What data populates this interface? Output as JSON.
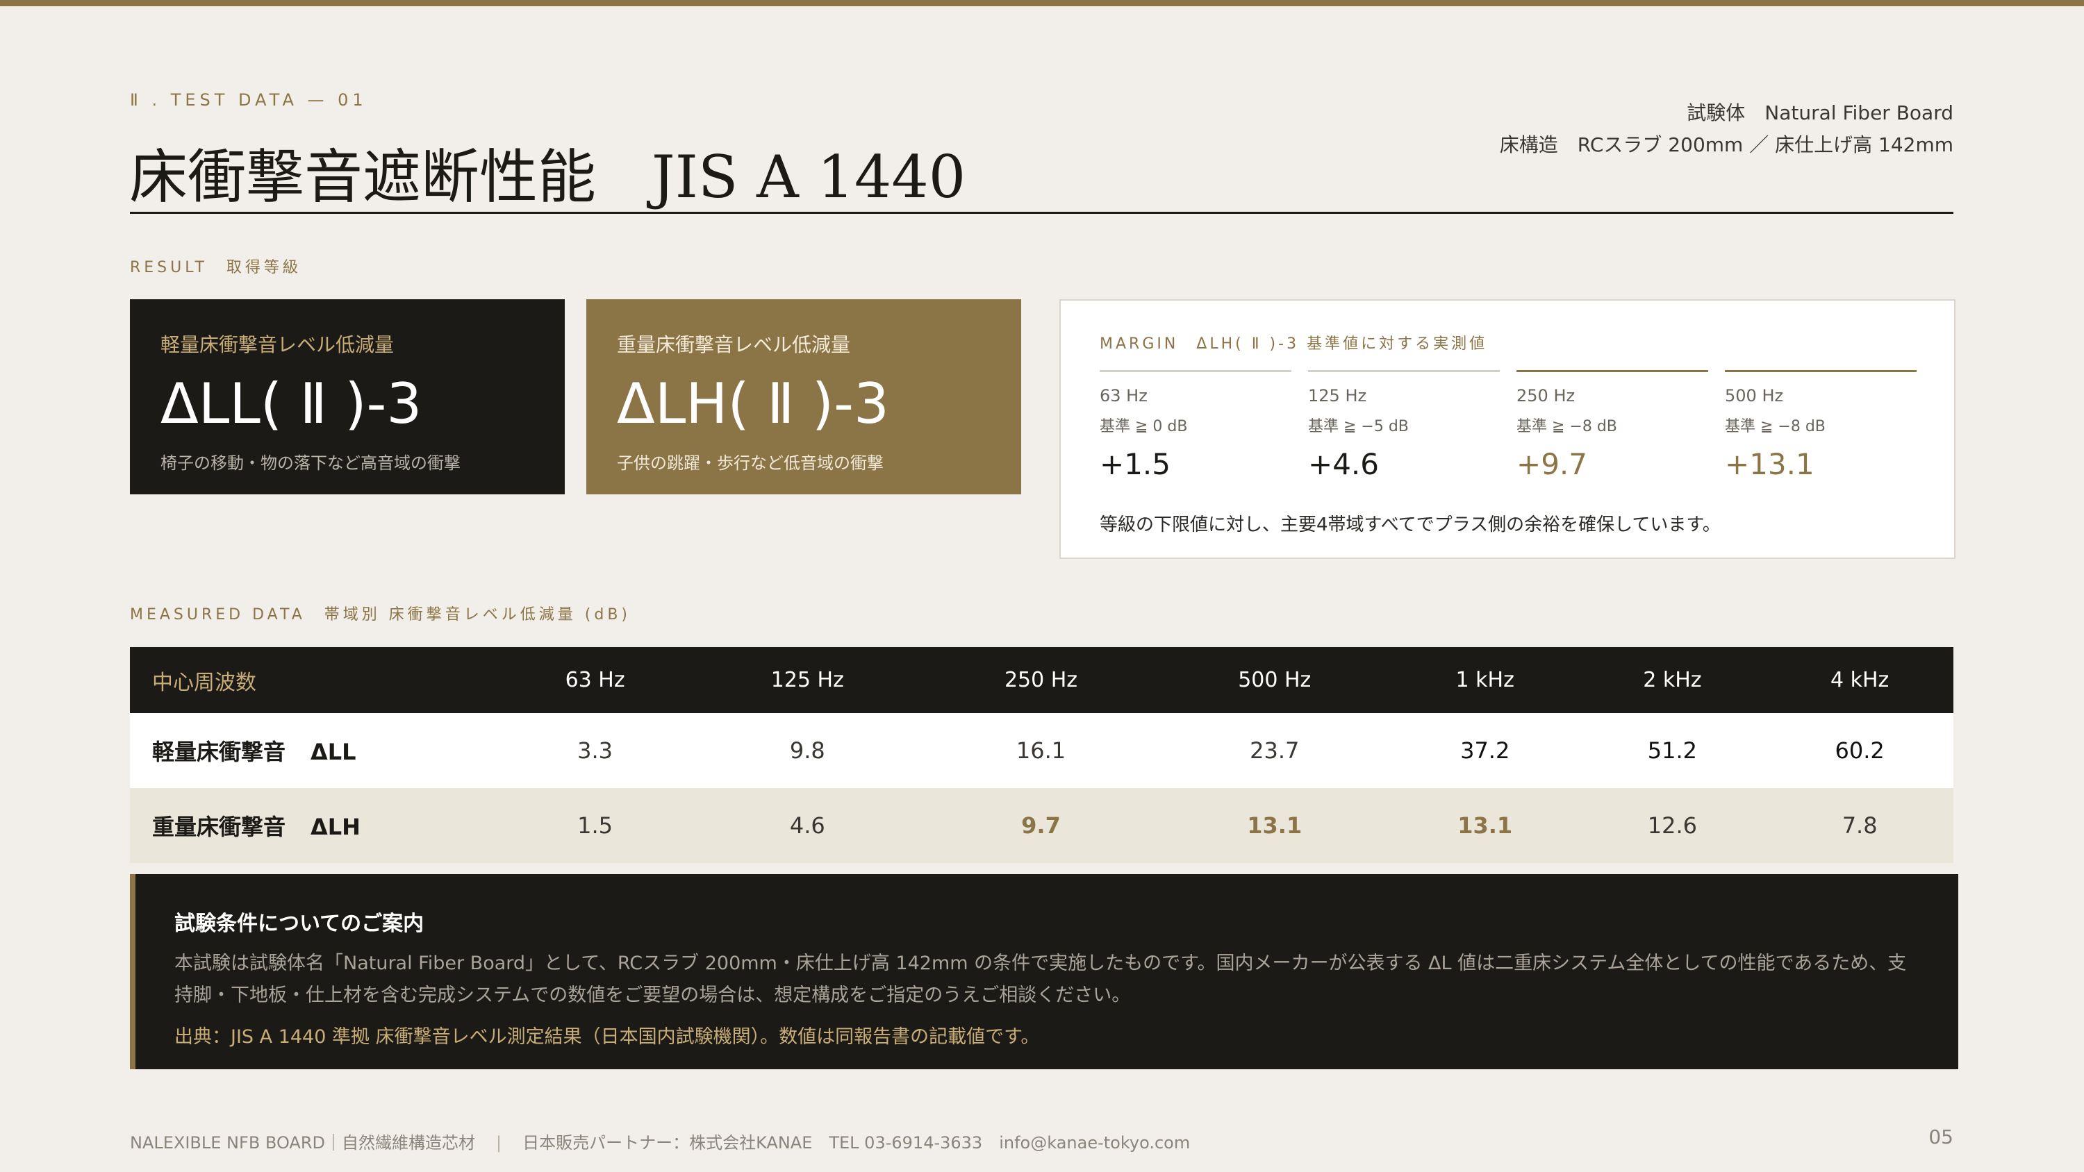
{
  "header": {
    "eyebrow": "Ⅱ . TEST DATA — 01",
    "title_ja": "床衝撃音遮断性能",
    "title_std": "JIS A 1440",
    "meta": [
      {
        "key": "試験体",
        "value": "Natural Fiber Board"
      },
      {
        "key": "床構造",
        "value": "RCスラブ 200mm ／ 床仕上げ高 142mm"
      }
    ]
  },
  "result": {
    "label": "RESULT　取得等級",
    "cards": [
      {
        "caption": "軽量床衝撃音レベル低減量",
        "grade": "ΔLL( Ⅱ )-3",
        "desc": "椅子の移動・物の落下など高音域の衝撃"
      },
      {
        "caption": "重量床衝撃音レベル低減量",
        "grade": "ΔLH( Ⅱ )-3",
        "desc": "子供の跳躍・歩行など低音域の衝撃"
      }
    ]
  },
  "margin": {
    "title": "MARGIN　ΔLH( Ⅱ )-3 基準値に対する実測値",
    "cols": [
      {
        "hz": "63 Hz",
        "std": "基準 ≧ 0 dB",
        "val": "+1.5"
      },
      {
        "hz": "125 Hz",
        "std": "基準 ≧ −5 dB",
        "val": "+4.6"
      },
      {
        "hz": "250 Hz",
        "std": "基準 ≧ −8 dB",
        "val": "+9.7"
      },
      {
        "hz": "500 Hz",
        "std": "基準 ≧ −8 dB",
        "val": "+13.1"
      }
    ],
    "note": "等級の下限値に対し、主要4帯域すべてでプラス側の余裕を確保しています。"
  },
  "measured": {
    "label": "MEASURED DATA　帯域別 床衝撃音レベル低減量 (dB)",
    "header": [
      "中心周波数",
      "63 Hz",
      "125 Hz",
      "250 Hz",
      "500 Hz",
      "1 kHz",
      "2 kHz",
      "4 kHz"
    ],
    "rows": [
      {
        "name": "軽量床衝撃音",
        "sym": "ΔLL",
        "values": [
          "3.3",
          "9.8",
          "16.1",
          "23.7",
          "37.2",
          "51.2",
          "60.2"
        ]
      },
      {
        "name": "重量床衝撃音",
        "sym": "ΔLH",
        "values": [
          "1.5",
          "4.6",
          "9.7",
          "13.1",
          "13.1",
          "12.6",
          "7.8"
        ]
      }
    ]
  },
  "info": {
    "title": "試験条件についてのご案内",
    "body": "本試験は試験体名「Natural Fiber Board」として、RCスラブ 200mm・床仕上げ高 142mm の条件で実施したものです。国内メーカーが公表する ΔL 値は二重床システム全体としての性能であるため、支持脚・下地板・仕上材を含む完成システムでの数値をご要望の場合は、想定構成をご指定のうえご相談ください。",
    "source": "出典：JIS A 1440 準拠 床衝撃音レベル測定結果（日本国内試験機関）。数値は同報告書の記載値です。"
  },
  "footer": {
    "brand": "NALEXIBLE NFB BOARD｜自然繊維構造芯材",
    "separator": "|",
    "partner": "日本販売パートナー：株式会社KANAE　TEL 03-6914-3633　info@kanae-tokyo.com",
    "page": "05"
  },
  "colors": {
    "accent": "#8b7446",
    "dark": "#1b1a17",
    "background": "#f2efea"
  }
}
